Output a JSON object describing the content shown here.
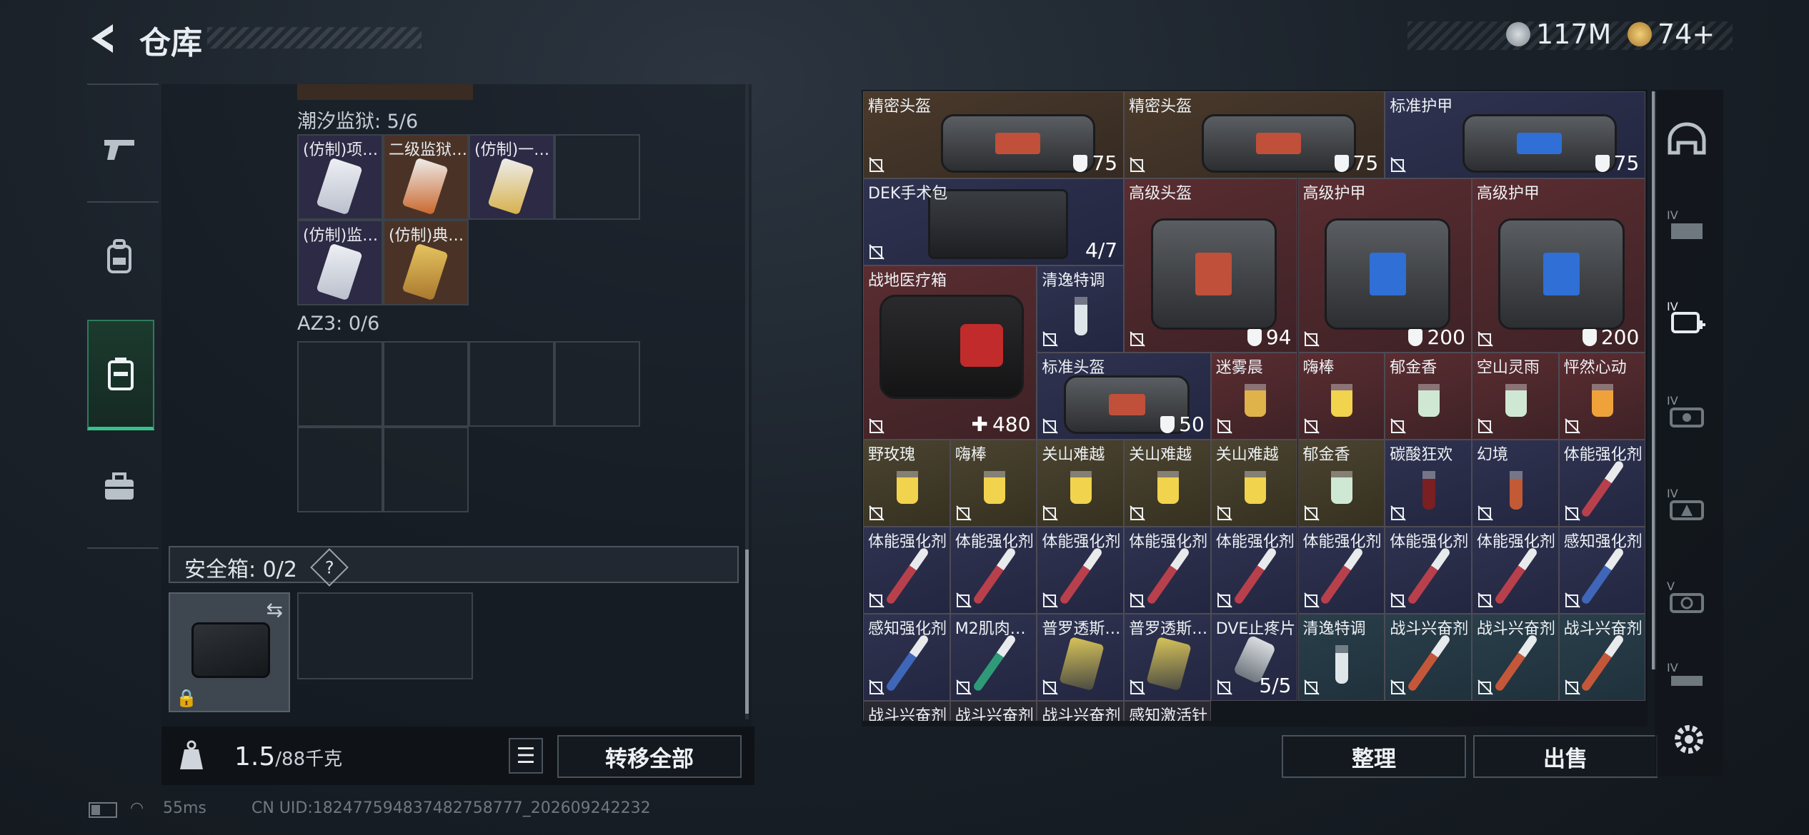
{
  "header": {
    "title": "仓库",
    "currency_1": "117M",
    "currency_2": "74+",
    "currency_1_color": "#b9c0c7",
    "currency_2_color": "#d4a94a"
  },
  "nav": {
    "items": [
      {
        "name": "weapon",
        "icon": "pistol-icon"
      },
      {
        "name": "backpack",
        "icon": "backpack-icon"
      },
      {
        "name": "container",
        "icon": "container-icon",
        "active": true
      },
      {
        "name": "briefcase",
        "icon": "briefcase-icon"
      }
    ]
  },
  "storage": {
    "section1_label": "潮汐监狱: 5/6",
    "section1_items": [
      "(仿制)项…",
      "二级监狱…",
      "(仿制)一…",
      "(仿制)监…",
      "(仿制)典…"
    ],
    "section2_label": "AZ3: 0/6",
    "safe_label": "安全箱: 0/2",
    "safe_help": "?",
    "weight_value": "1.5",
    "weight_unit": "/88千克",
    "transfer_all": "转移全部"
  },
  "inventory": {
    "cells": [
      {
        "label": "精密头盔",
        "value": "75"
      },
      {
        "label": "精密头盔",
        "value": "75"
      },
      {
        "label": "标准护甲",
        "value": "75"
      },
      {
        "label": "DEK手术包",
        "value": "4/7"
      },
      {
        "label": "高级头盔",
        "value": "94"
      },
      {
        "label": "高级护甲",
        "value": "200"
      },
      {
        "label": "高级护甲",
        "value": "200"
      },
      {
        "label": "战地医疗箱",
        "value": "480"
      },
      {
        "label": "清逸特调",
        "value": ""
      },
      {
        "label": "标准头盔",
        "value": "50"
      },
      {
        "label": "迷雾晨",
        "value": ""
      },
      {
        "label": "嗨棒",
        "value": ""
      },
      {
        "label": "郁金香",
        "value": ""
      },
      {
        "label": "空山灵雨",
        "value": ""
      },
      {
        "label": "怦然心动",
        "value": ""
      },
      {
        "label": "野玫瑰",
        "value": ""
      },
      {
        "label": "嗨棒",
        "value": ""
      },
      {
        "label": "关山难越",
        "value": ""
      },
      {
        "label": "关山难越",
        "value": ""
      },
      {
        "label": "关山难越",
        "value": ""
      },
      {
        "label": "郁金香",
        "value": ""
      },
      {
        "label": "碳酸狂欢",
        "value": ""
      },
      {
        "label": "幻境",
        "value": ""
      },
      {
        "label": "体能强化剂",
        "value": ""
      },
      {
        "label": "体能强化剂",
        "value": ""
      },
      {
        "label": "体能强化剂",
        "value": ""
      },
      {
        "label": "体能强化剂",
        "value": ""
      },
      {
        "label": "体能强化剂",
        "value": ""
      },
      {
        "label": "体能强化剂",
        "value": ""
      },
      {
        "label": "体能强化剂",
        "value": ""
      },
      {
        "label": "体能强化剂",
        "value": ""
      },
      {
        "label": "体能强化剂",
        "value": ""
      },
      {
        "label": "感知强化剂",
        "value": ""
      },
      {
        "label": "感知强化剂",
        "value": ""
      },
      {
        "label": "M2肌肉…",
        "value": ""
      },
      {
        "label": "普罗透斯…",
        "value": ""
      },
      {
        "label": "普罗透斯…",
        "value": ""
      },
      {
        "label": "DVE止疼片",
        "value": "5/5"
      },
      {
        "label": "清逸特调",
        "value": ""
      },
      {
        "label": "战斗兴奋剂",
        "value": ""
      },
      {
        "label": "战斗兴奋剂",
        "value": ""
      },
      {
        "label": "战斗兴奋剂",
        "value": ""
      },
      {
        "label": "战斗兴奋剂",
        "value": ""
      },
      {
        "label": "战斗兴奋剂",
        "value": ""
      },
      {
        "label": "战斗兴奋剂",
        "value": ""
      },
      {
        "label": "感知激活针",
        "value": ""
      }
    ],
    "sort_button": "整理",
    "sell_button": "出售"
  },
  "status": {
    "ping": "55ms",
    "uid": "CN UID:182477594837482758777_202609242232"
  }
}
